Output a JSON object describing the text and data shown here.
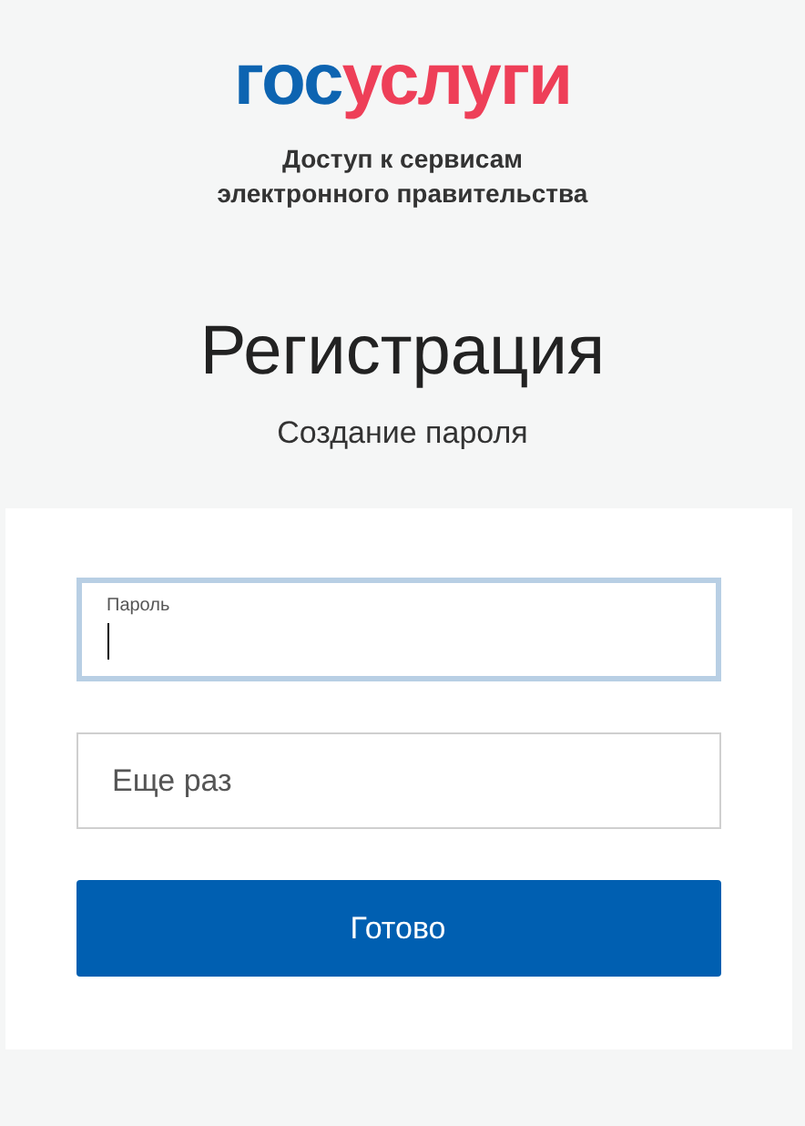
{
  "logo": {
    "parts": [
      {
        "text": "гос",
        "color": "#0d64b1"
      },
      {
        "text": "услуги",
        "color": "#ee3f58"
      }
    ]
  },
  "tagline": [
    "Доступ к сервисам",
    "электронного правительства"
  ],
  "title": "Регистрация",
  "subtitle": "Создание пароля",
  "fields": [
    {
      "label": "Пароль",
      "focused": true
    },
    {
      "placeholder": "Еще раз",
      "focused": false
    }
  ],
  "submit_button": "Готово"
}
